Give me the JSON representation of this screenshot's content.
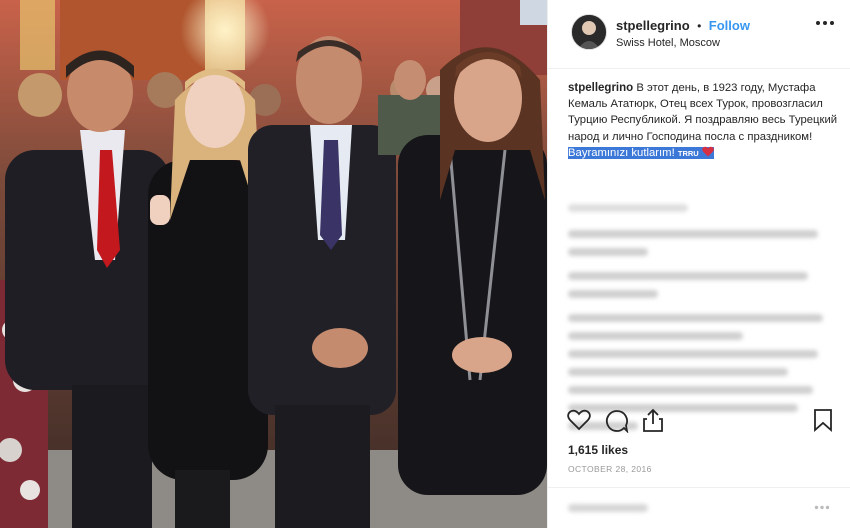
{
  "post": {
    "username": "stpellegrino",
    "separator": "•",
    "follow_label": "Follow",
    "location": "Swiss Hotel, Moscow",
    "caption_user": "stpellegrino",
    "caption_text": "В этот день, в 1923 году, Мустафа Кемаль Ататюрк, Отец всех Турок, провозгласил Турцию Республикой. Я поздравляю весь Турецкий народ и лично Господина посла с праздником!",
    "caption_highlight": "Bayramınızı kutlarım!",
    "caption_tag": "TRRU",
    "likes": "1,615 likes",
    "date": "OCTOBER 28, 2016"
  },
  "icons": {
    "heart": "heart-icon",
    "comment": "comment-icon",
    "share": "share-icon",
    "save": "bookmark-icon",
    "more": "more-icon"
  },
  "colors": {
    "follow": "#3897f0",
    "highlight": "#3c78d8",
    "heart": "#d62e43"
  }
}
